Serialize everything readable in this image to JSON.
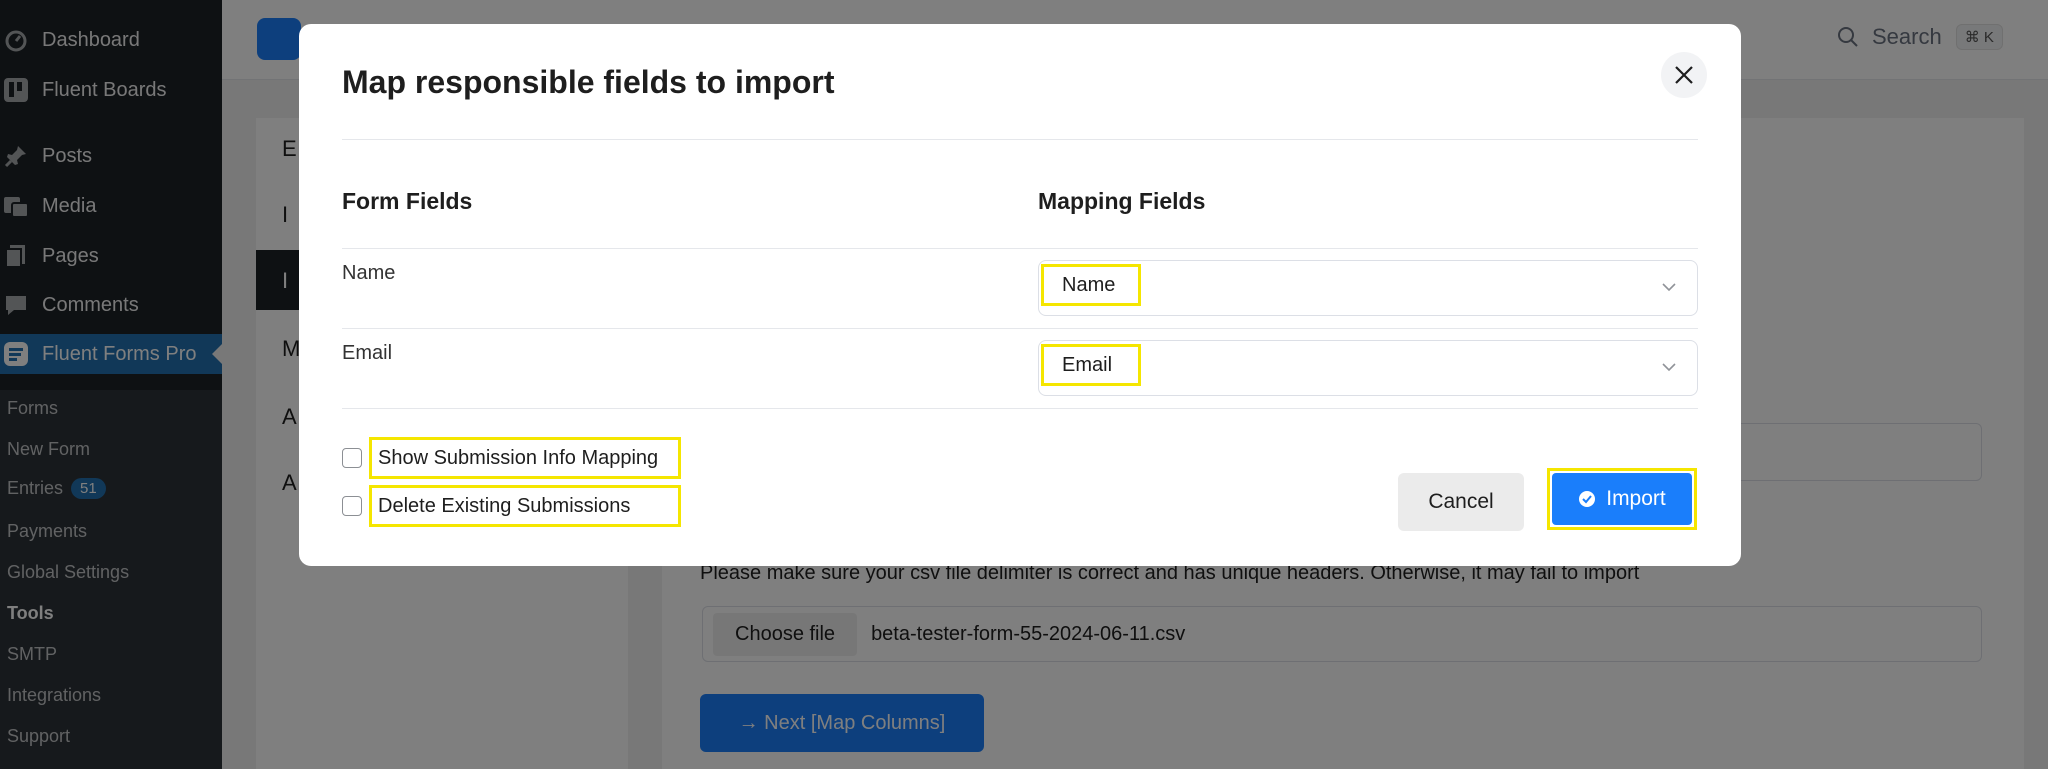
{
  "sidebar": {
    "items": [
      {
        "label": "Dashboard",
        "icon": "dashboard-icon"
      },
      {
        "label": "Fluent Boards",
        "icon": "boards-icon"
      },
      {
        "label": "Posts",
        "icon": "pin-icon"
      },
      {
        "label": "Media",
        "icon": "media-icon"
      },
      {
        "label": "Pages",
        "icon": "pages-icon"
      },
      {
        "label": "Comments",
        "icon": "comment-icon"
      },
      {
        "label": "Fluent Forms Pro",
        "icon": "fluent-forms-icon"
      }
    ],
    "submenu": [
      {
        "label": "Forms"
      },
      {
        "label": "New Form"
      },
      {
        "label": "Entries",
        "badge": "51"
      },
      {
        "label": "Payments"
      },
      {
        "label": "Global Settings"
      },
      {
        "label": "Tools"
      },
      {
        "label": "SMTP"
      },
      {
        "label": "Integrations"
      },
      {
        "label": "Support"
      }
    ]
  },
  "header": {
    "search_label": "Search",
    "search_shortcut": "⌘ K"
  },
  "left_panel": {
    "items": [
      "E",
      "I",
      "I",
      "M",
      "A",
      "A"
    ]
  },
  "background": {
    "note": "Please make sure your csv file delimiter is correct and has unique headers. Otherwise, it may fail to import",
    "choose_file_label": "Choose file",
    "file_name": "beta-tester-form-55-2024-06-11.csv",
    "next_button": "→ Next [Map Columns]"
  },
  "modal": {
    "title": "Map responsible fields to import",
    "form_fields_header": "Form Fields",
    "mapping_fields_header": "Mapping Fields",
    "rows": [
      {
        "label": "Name",
        "value": "Name"
      },
      {
        "label": "Email",
        "value": "Email"
      }
    ],
    "show_submission_info": "Show Submission Info Mapping",
    "delete_existing": "Delete Existing Submissions",
    "cancel_label": "Cancel",
    "import_label": "Import"
  },
  "colors": {
    "accent": "#1a7efb",
    "highlight": "#f5e600",
    "sidebar_bg": "#1d2327"
  }
}
